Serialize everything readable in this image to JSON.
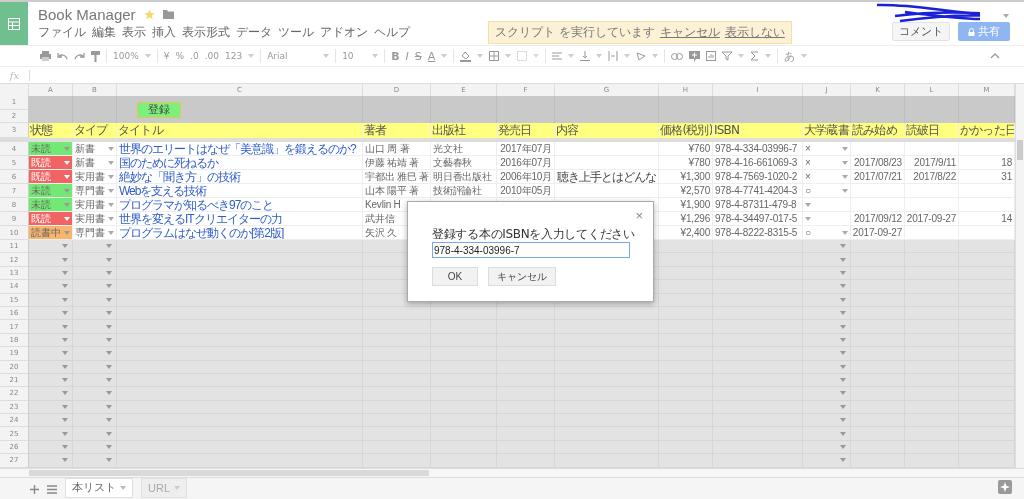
{
  "app": {
    "title": "Book Manager",
    "menu": [
      "ファイル",
      "編集",
      "表示",
      "挿入",
      "表示形式",
      "データ",
      "ツール",
      "アドオン",
      "ヘルプ"
    ]
  },
  "notice": {
    "text": "スクリプト を実行しています",
    "links": [
      "キャンセル",
      "表示しない"
    ]
  },
  "header_buttons": {
    "comment": "コメント",
    "share": "共有"
  },
  "toolbar": {
    "zoom": "100%",
    "currency": "¥",
    "percent": "%",
    "dec_less": ".0",
    "dec_more": ".00",
    "format": "123",
    "font": "Arial",
    "size": "10",
    "bold": "B",
    "italic": "I",
    "strike": "S",
    "text_color": "A",
    "input_tool": "あ"
  },
  "formula_bar": {
    "label": "fx"
  },
  "sheet": {
    "columns": [
      "A",
      "B",
      "C",
      "D",
      "E",
      "F",
      "G",
      "H",
      "I",
      "J",
      "K",
      "L",
      "M"
    ],
    "register_button": "登録",
    "band_rows": [
      "1",
      "2"
    ],
    "header_row": {
      "number": "3",
      "cells": [
        "状態",
        "タイプ",
        "タイトル",
        "著者",
        "出版社",
        "発売日",
        "内容",
        "価格(税別)",
        "ISBN",
        "大学蔵書",
        "読み始め",
        "読破日",
        "かかった日"
      ]
    },
    "rows": [
      {
        "number": "4",
        "status": {
          "text": "未読",
          "color": "#74e874"
        },
        "type": "新書",
        "title": "世界のエリートはなぜ「美意識」を鍛えるのか?",
        "author": "山口 周 著",
        "publisher": "光文社",
        "release": "2017年07月",
        "price": "¥760",
        "isbn": "978-4-334-03996-7",
        "library": "×"
      },
      {
        "number": "5",
        "status": {
          "text": "既読",
          "color": "#f06464"
        },
        "type": "新書",
        "title": "国のために死ねるか",
        "author": "伊藤 祐靖 著",
        "publisher": "文藝春秋",
        "release": "2016年07月",
        "price": "¥780",
        "isbn": "978-4-16-661069-3",
        "library": "×",
        "start": "2017/08/23",
        "finish": "2017/9/11",
        "days": "18"
      },
      {
        "number": "6",
        "status": {
          "text": "既読",
          "color": "#f06464"
        },
        "type": "実用書",
        "title": "絶妙な「聞き方」の技術",
        "author": "宇都出 雅巳 著",
        "publisher": "明日香出版社",
        "release": "2006年10月",
        "content": "聴き上手とはどんな",
        "price": "¥1,300",
        "isbn": "978-4-7569-1020-2",
        "library": "×",
        "start": "2017/07/21",
        "finish": "2017/8/22",
        "days": "31"
      },
      {
        "number": "7",
        "status": {
          "text": "未読",
          "color": "#74e874"
        },
        "type": "専門書",
        "title": "Webを支える技術",
        "author": "山本 陽平 著",
        "publisher": "技術評論社",
        "release": "2010年05月",
        "price": "¥2,570",
        "isbn": "978-4-7741-4204-3",
        "library": "○"
      },
      {
        "number": "8",
        "status": {
          "text": "未読",
          "color": "#74e874"
        },
        "type": "実用書",
        "title": "プログラマが知るべき97のこと",
        "author": "Kevlin H",
        "price": "¥1,900",
        "isbn": "978-4-87311-479-8"
      },
      {
        "number": "9",
        "status": {
          "text": "既読",
          "color": "#f06464"
        },
        "type": "実用書",
        "title": "世界を変えるITクリエイターの力",
        "author": "武井信",
        "price": "¥1,296",
        "isbn": "978-4-34497-017-5",
        "start": "2017/09/12",
        "finish": "2017-09-27",
        "days": "14"
      },
      {
        "number": "10",
        "status": {
          "text": "読書中",
          "color": "#f8b56c"
        },
        "type": "専門書",
        "title": "プログラムはなぜ動くのか[第2版]",
        "author": "矢沢 久",
        "price": "¥2,400",
        "isbn": "978-4-8222-8315-5",
        "library": "○",
        "start": "2017-09-27"
      }
    ],
    "empty_rows": [
      "11",
      "12",
      "13",
      "14",
      "15",
      "16",
      "17",
      "18",
      "19",
      "20",
      "21",
      "22",
      "23",
      "24",
      "25",
      "26",
      "27"
    ]
  },
  "dialog": {
    "close": "×",
    "prompt": "登録する本のISBNを入力してください",
    "value": "978-4-334-03996-7",
    "buttons": [
      "OK",
      "キャンセル"
    ]
  },
  "sheet_tabs": [
    {
      "label": "本リスト",
      "selected": true
    },
    {
      "label": "URL",
      "selected": false
    }
  ]
}
